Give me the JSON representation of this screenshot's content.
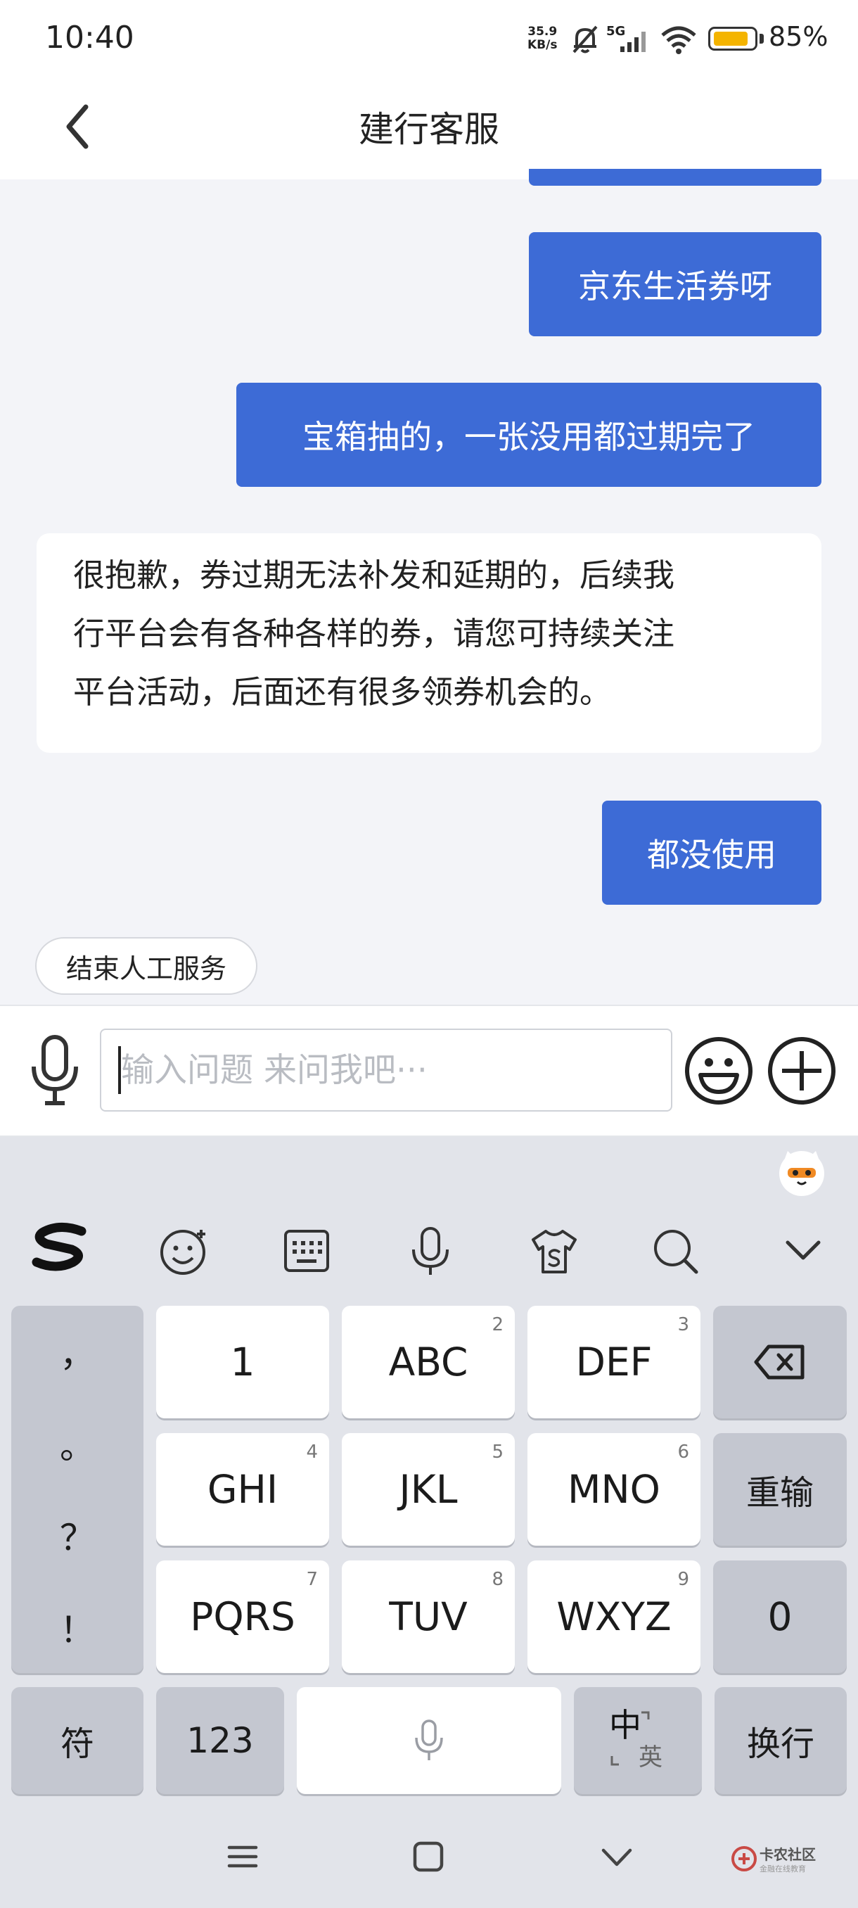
{
  "status_bar": {
    "time": "10:40",
    "network_speed_value": "35.9",
    "network_speed_unit": "KB/s",
    "signal_label": "5G",
    "battery_percent": "85%",
    "battery_level": 0.85
  },
  "header": {
    "title": "建行客服"
  },
  "chat": {
    "messages": [
      {
        "from": "user",
        "text": "京东生活券呀"
      },
      {
        "from": "user",
        "text": "宝箱抽的，一张没用都过期完了"
      },
      {
        "from": "agent",
        "lines": [
          "很抱歉，券过期无法补发和延期的，后续我",
          "行平台会有各种各样的券，请您可持续关注",
          "平台活动，后面还有很多领券机会的。"
        ]
      },
      {
        "from": "user",
        "text": "都没使用"
      }
    ],
    "end_service_label": "结束人工服务"
  },
  "input": {
    "placeholder": "输入问题 来问我吧···",
    "value": ""
  },
  "keyboard": {
    "punctuation": [
      "，",
      "。",
      "？",
      "！"
    ],
    "keys": [
      {
        "label": "1",
        "num": ""
      },
      {
        "label": "ABC",
        "num": "2"
      },
      {
        "label": "DEF",
        "num": "3"
      },
      {
        "label": "GHI",
        "num": "4"
      },
      {
        "label": "JKL",
        "num": "5"
      },
      {
        "label": "MNO",
        "num": "6"
      },
      {
        "label": "PQRS",
        "num": "7"
      },
      {
        "label": "TUV",
        "num": "8"
      },
      {
        "label": "WXYZ",
        "num": "9"
      }
    ],
    "reset_label": "重输",
    "zero_label": "0",
    "symbols_label": "符",
    "numbers_label": "123",
    "lang_main": "中",
    "lang_alt": "英",
    "enter_label": "换行"
  },
  "watermark": {
    "title": "卡农社区",
    "subtitle": "金融在线教育"
  },
  "colors": {
    "accent": "#3d6bd6",
    "background": "#f3f4f8"
  }
}
